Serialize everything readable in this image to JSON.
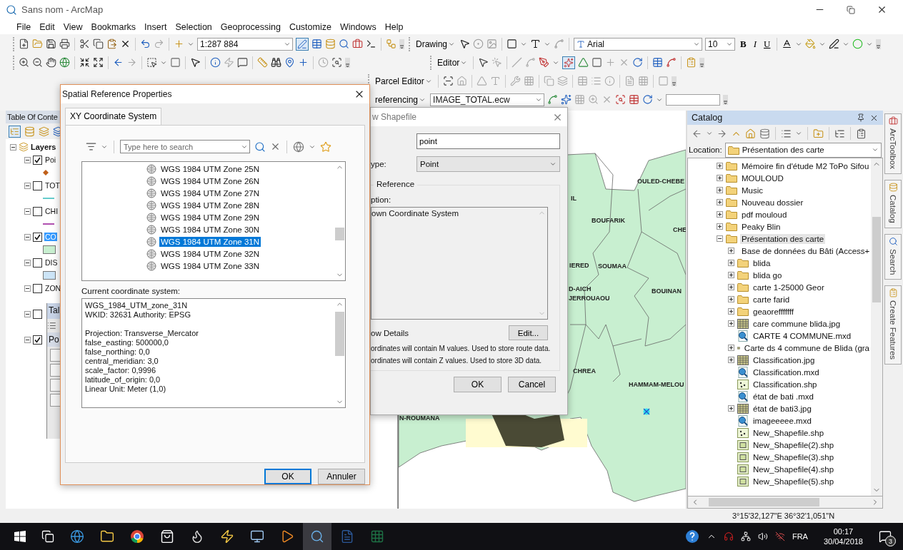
{
  "window": {
    "title": "Sans nom - ArcMap"
  },
  "menu": [
    "File",
    "Edit",
    "View",
    "Bookmarks",
    "Insert",
    "Selection",
    "Geoprocessing",
    "Customize",
    "Windows",
    "Help"
  ],
  "standard_toolbar": {
    "scale": "1:287 884"
  },
  "drawing_toolbar": {
    "label": "Drawing",
    "font": "Arial",
    "font_size": "10",
    "style_buttons": [
      "B",
      "I",
      "U"
    ]
  },
  "editor_toolbar": {
    "label": "Editor"
  },
  "parcel_toolbar": {
    "label": "Parcel Editor"
  },
  "georef_toolbar": {
    "label": "referencing",
    "layer": "IMAGE_TOTAL.ecw"
  },
  "toc": {
    "title": "Table Of Conte",
    "root": "Layers",
    "layers": [
      {
        "name": "Poi",
        "checked": true,
        "expanded": true,
        "selected": false,
        "legend": {
          "kind": "point",
          "color": "#c0601a"
        }
      },
      {
        "name": "TOT",
        "checked": false,
        "expanded": true,
        "selected": false,
        "legend": {
          "kind": "line",
          "color": "#66cccc"
        }
      },
      {
        "name": "CHI",
        "checked": false,
        "expanded": true,
        "selected": false,
        "legend": {
          "kind": "line",
          "color": "#b050b0"
        }
      },
      {
        "name": "CO",
        "checked": true,
        "expanded": true,
        "selected": true,
        "legend": {
          "kind": "fill",
          "color": "#c8efd0"
        }
      },
      {
        "name": "DIS",
        "checked": false,
        "expanded": true,
        "selected": false,
        "legend": {
          "kind": "fill",
          "color": "#cce4f7"
        }
      },
      {
        "name": "ZON",
        "checked": false,
        "expanded": true,
        "selected": false
      },
      {
        "checked": false,
        "expanded": true
      },
      {
        "checked": true,
        "expanded": true
      }
    ]
  },
  "table_window": {
    "title": "Tal",
    "tab": "Po"
  },
  "spatial_reference_dialog": {
    "title": "Spatial Reference Properties",
    "tabs": [
      {
        "label": "XY Coordinate System",
        "selected": true
      }
    ],
    "search_placeholder": "Type here to search",
    "systems": [
      {
        "name": "WGS 1984 UTM Zone 25N",
        "selected": false
      },
      {
        "name": "WGS 1984 UTM Zone 26N",
        "selected": false
      },
      {
        "name": "WGS 1984 UTM Zone 27N",
        "selected": false
      },
      {
        "name": "WGS 1984 UTM Zone 28N",
        "selected": false
      },
      {
        "name": "WGS 1984 UTM Zone 29N",
        "selected": false
      },
      {
        "name": "WGS 1984 UTM Zone 30N",
        "selected": false
      },
      {
        "name": "WGS 1984 UTM Zone 31N",
        "selected": true
      },
      {
        "name": "WGS 1984 UTM Zone 32N",
        "selected": false
      },
      {
        "name": "WGS 1984 UTM Zone 33N",
        "selected": false
      }
    ],
    "current_label": "Current coordinate system:",
    "details": [
      [
        "WGS_1984_UTM_zone_31N",
        "WKID: 32631 Authority: EPSG"
      ],
      [
        "Projection: Transverse_Mercator",
        "false_easting: 500000,0",
        "false_northing: 0,0",
        "central_meridian: 3,0",
        "scale_factor: 0,9996",
        "latitude_of_origin: 0,0",
        "Linear Unit: Meter (1,0)"
      ]
    ],
    "buttons": [
      {
        "label": "OK",
        "default": true
      },
      {
        "label": "Annuler",
        "default": false
      }
    ]
  },
  "new_shapefile_dialog": {
    "title": "w Shapefile",
    "name_value": "point",
    "type_label": "ype:",
    "type_value": "Point",
    "group_label": "Reference",
    "description_label": "ption:",
    "description": "own Coordinate System",
    "details_label": "ow Details",
    "edit_button": "Edit...",
    "notes": [
      "ordinates will contain M values. Used to store route data.",
      "ordinates will contain Z values. Used to store 3D data."
    ],
    "buttons": [
      "OK",
      "Cancel"
    ]
  },
  "map": {
    "labels": [
      "OULED-CHEBE",
      "IL",
      "BOUFARIK",
      "CHE",
      "IERED",
      "SOUMAA",
      "D-AICH",
      "JERROUAOU",
      "BOUINAN",
      "CHREA",
      "HAMMAM-MELOU",
      "N-ROUMANA"
    ]
  },
  "catalog": {
    "title": "Catalog",
    "location_label": "Location:",
    "location": "Présentation des carte",
    "items": [
      {
        "name": "Mémoire fin d'étude M2 ToPo Sifou",
        "kind": "folder",
        "expanded": false,
        "selected": false
      },
      {
        "name": "MOULOUD",
        "kind": "folder",
        "expanded": false,
        "selected": false
      },
      {
        "name": "Music",
        "kind": "folder",
        "expanded": false,
        "selected": false
      },
      {
        "name": "Nouveau dossier",
        "kind": "folder",
        "expanded": false,
        "selected": false
      },
      {
        "name": "pdf mouloud",
        "kind": "folder",
        "expanded": false,
        "selected": false
      },
      {
        "name": "Peaky Blin",
        "kind": "folder",
        "expanded": false,
        "selected": false
      },
      {
        "name": "Présentation des carte",
        "kind": "folder",
        "expanded": true,
        "selected": true,
        "children": [
          {
            "name": "Base de données du Bâti (Access+",
            "kind": "folder",
            "expanded": false,
            "selected": false
          },
          {
            "name": "blida",
            "kind": "folder",
            "expanded": false,
            "selected": false
          },
          {
            "name": "blida go",
            "kind": "folder",
            "expanded": false,
            "selected": false
          },
          {
            "name": "carte 1-25000 Geor",
            "kind": "folder",
            "expanded": false,
            "selected": false
          },
          {
            "name": "carte farid",
            "kind": "folder",
            "expanded": false,
            "selected": false
          },
          {
            "name": "geaorefffffff",
            "kind": "folder",
            "expanded": false,
            "selected": false
          },
          {
            "name": "care commune blida.jpg",
            "kind": "raster",
            "expanded": false,
            "selected": false
          },
          {
            "name": "CARTE 4 COMMUNE.mxd",
            "kind": "map_document",
            "selected": false
          },
          {
            "name": "Carte ds 4 commune de Blida (gra",
            "kind": "raster",
            "expanded": false,
            "selected": false
          },
          {
            "name": "Classification.jpg",
            "kind": "raster",
            "expanded": false,
            "selected": false
          },
          {
            "name": "Classification.mxd",
            "kind": "map_document",
            "selected": false
          },
          {
            "name": "Classification.shp",
            "kind": "point_shapefile",
            "selected": false
          },
          {
            "name": "état de bati .mxd",
            "kind": "map_document",
            "selected": false
          },
          {
            "name": "état de bati3.jpg",
            "kind": "raster",
            "expanded": false,
            "selected": false
          },
          {
            "name": "imageeeee.mxd",
            "kind": "map_document",
            "selected": false
          },
          {
            "name": "New_Shapefile.shp",
            "kind": "point_shapefile",
            "selected": false
          },
          {
            "name": "New_Shapefile(2).shp",
            "kind": "polygon_shapefile",
            "selected": false
          },
          {
            "name": "New_Shapefile(3).shp",
            "kind": "polygon_shapefile",
            "selected": false
          },
          {
            "name": "New_Shapefile(4).shp",
            "kind": "polygon_shapefile",
            "selected": false
          },
          {
            "name": "New_Shapefile(5).shp",
            "kind": "polygon_shapefile",
            "selected": false
          }
        ]
      }
    ]
  },
  "side_tabs": [
    "ArcToolbox",
    "Catalog",
    "Search",
    "Create Features"
  ],
  "status_bar": {
    "coordinates": "3°15'32,127\"E  36°32'1,051\"N"
  },
  "taskbar": {
    "language": "FRA",
    "time": "00:17",
    "date": "30/04/2018",
    "notifications": "3"
  }
}
